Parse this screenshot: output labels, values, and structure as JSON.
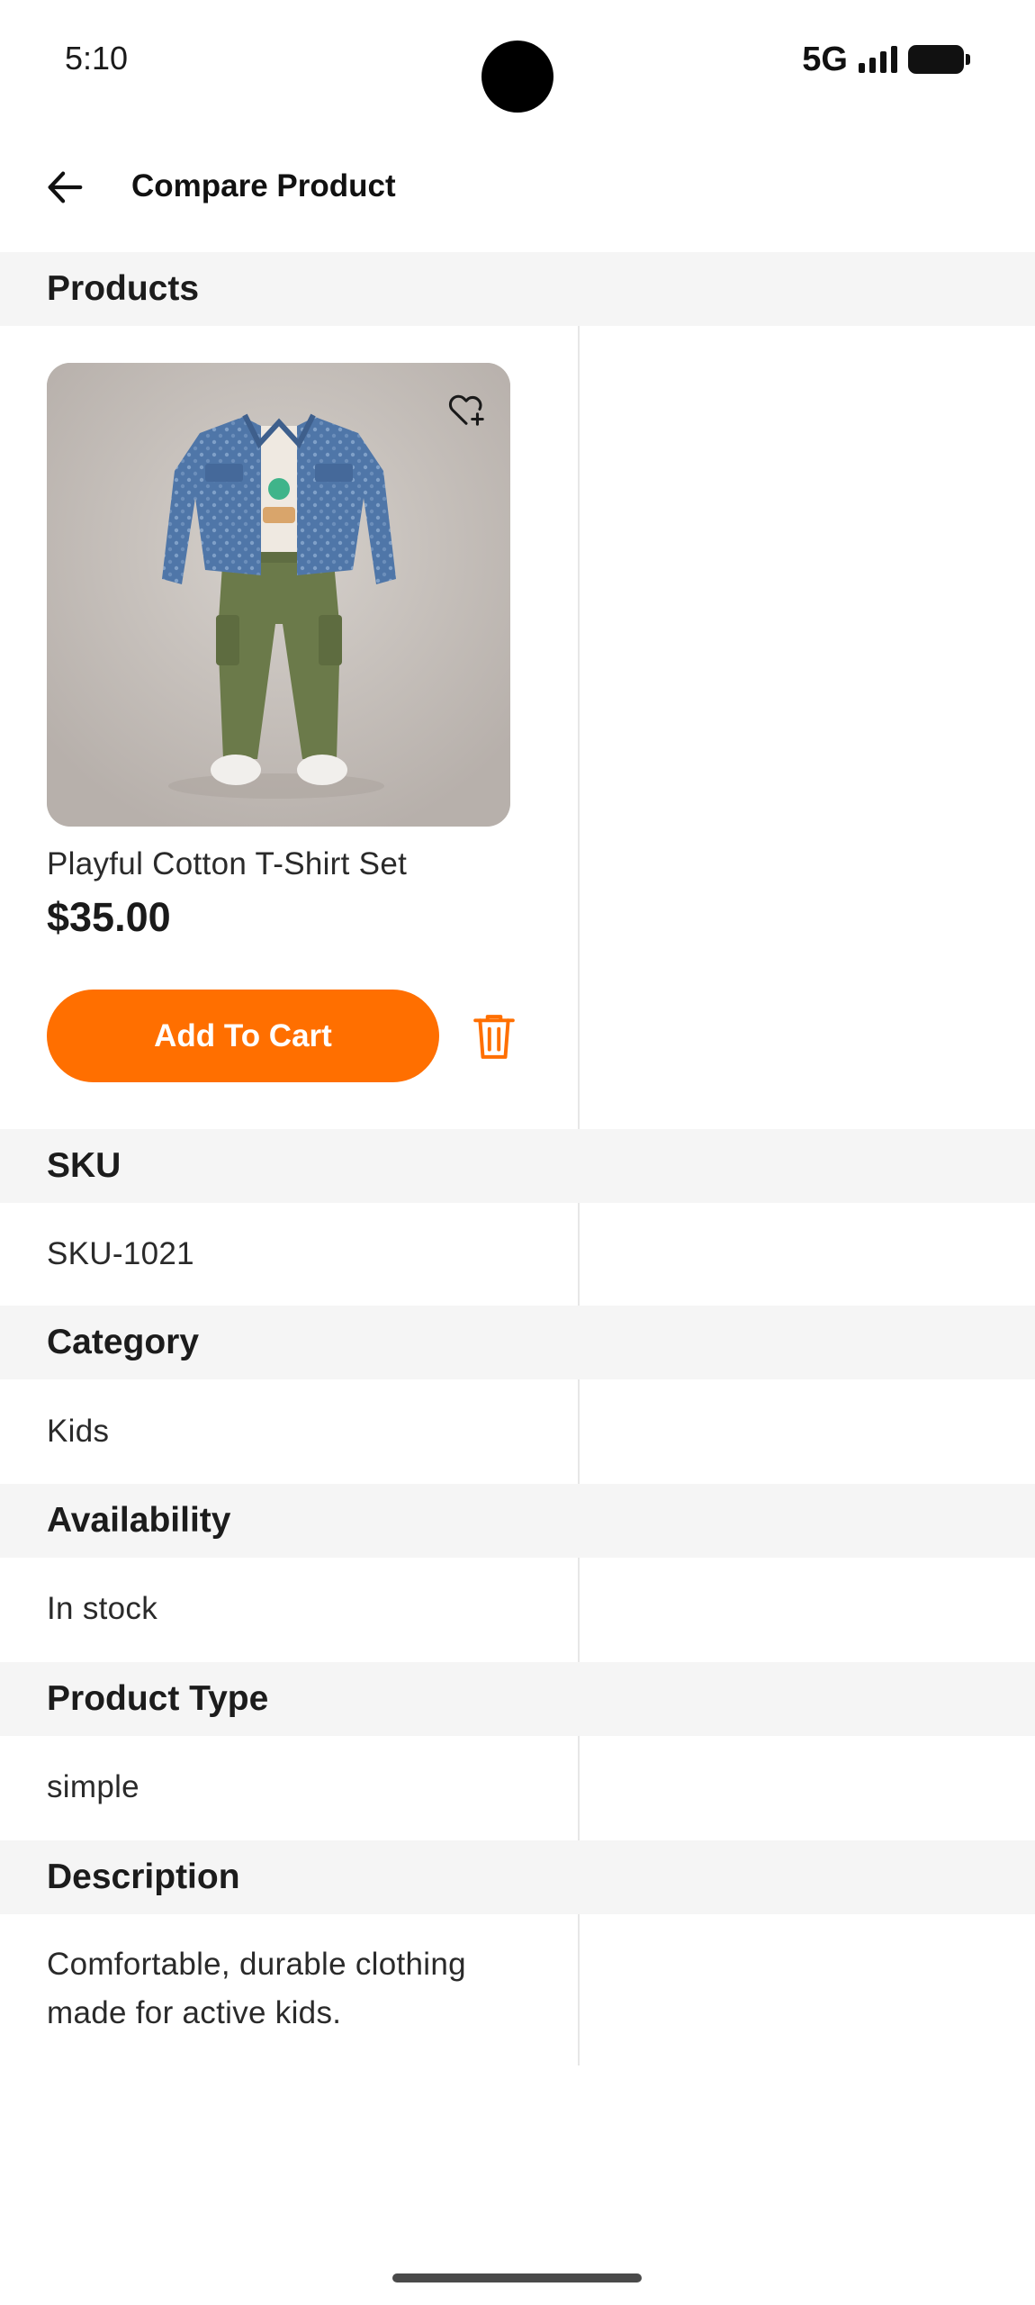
{
  "status_bar": {
    "time": "5:10",
    "network": "5G"
  },
  "app_bar": {
    "title": "Compare Product",
    "back_icon": "arrow-left-icon"
  },
  "sections": {
    "products": "Products",
    "sku": "SKU",
    "category": "Category",
    "availability": "Availability",
    "product_type": "Product Type",
    "description": "Description"
  },
  "product": {
    "image_alt": "Kids denim jacket with green cargo pants",
    "name": "Playful Cotton T-Shirt Set",
    "price": "$35.00",
    "add_to_cart_label": "Add To Cart",
    "wishlist_icon": "heart-plus-icon",
    "remove_icon": "trash-icon",
    "sku": "SKU-1021",
    "category": "Kids",
    "availability": "In stock",
    "product_type": "simple",
    "description": "Comfortable, durable clothing made for active kids."
  },
  "colors": {
    "accent": "#ff6f00",
    "section_bg": "#f5f5f5",
    "divider": "#e6e6e6"
  }
}
